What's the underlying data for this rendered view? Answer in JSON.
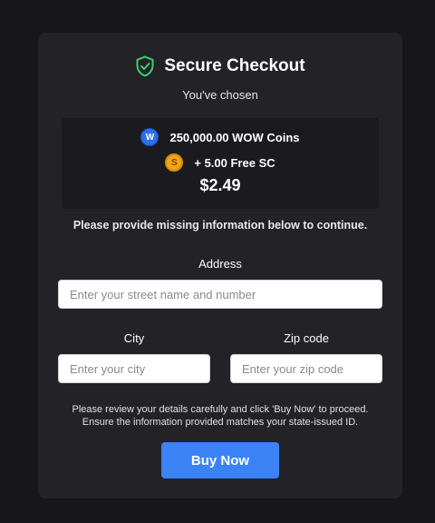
{
  "header": {
    "title": "Secure Checkout",
    "icon": "shield-check-icon",
    "icon_color": "#3ecf6e"
  },
  "subtitle": "You've chosen",
  "summary": {
    "coins": {
      "icon": "wow-coin-icon",
      "icon_letter": "W",
      "label": "250,000.00 WOW Coins"
    },
    "bonus": {
      "icon": "sc-coin-icon",
      "icon_letter": "S",
      "label": "+ 5.00 Free SC"
    },
    "price": "$2.49"
  },
  "notice": "Please provide missing information below to continue.",
  "form": {
    "address": {
      "label": "Address",
      "placeholder": "Enter your street name and number",
      "value": ""
    },
    "city": {
      "label": "City",
      "placeholder": "Enter your city",
      "value": ""
    },
    "zip": {
      "label": "Zip code",
      "placeholder": "Enter your zip code",
      "value": ""
    }
  },
  "disclaimer": {
    "line1": "Please review your details carefully and click 'Buy Now' to proceed.",
    "line2": "Ensure the information provided matches your state-issued ID."
  },
  "buy_button": {
    "label": "Buy Now",
    "color": "#3b82f6"
  },
  "colors": {
    "background": "#17171b",
    "card": "#222227",
    "summary_panel": "#1b1b1f"
  }
}
